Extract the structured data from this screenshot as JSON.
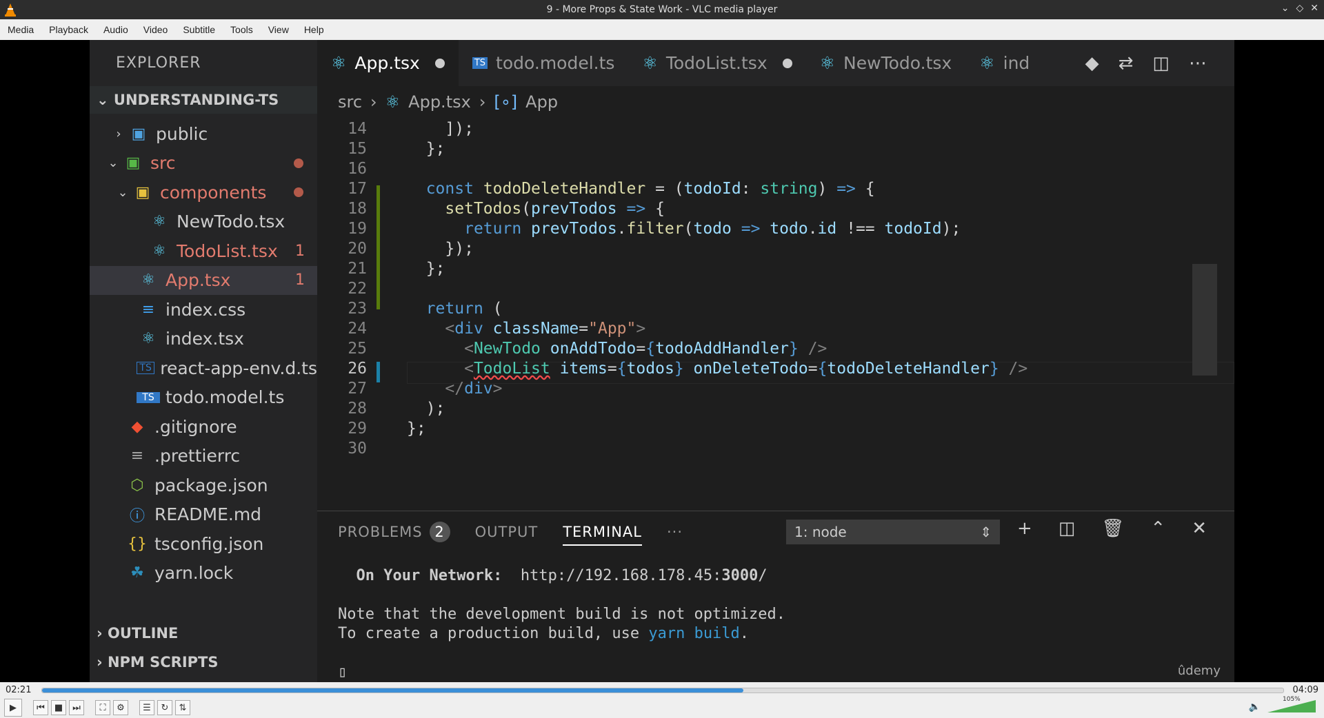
{
  "window": {
    "title": "9 - More Props & State Work - VLC media player"
  },
  "menu": [
    "Media",
    "Playback",
    "Audio",
    "Video",
    "Subtitle",
    "Tools",
    "View",
    "Help"
  ],
  "explorer": {
    "title": "EXPLORER",
    "project": "UNDERSTANDING-TS",
    "items": [
      {
        "label": "public",
        "kind": "folder"
      },
      {
        "label": "src",
        "kind": "folder-open"
      },
      {
        "label": "components",
        "kind": "folder-open"
      },
      {
        "label": "NewTodo.tsx",
        "kind": "react"
      },
      {
        "label": "TodoList.tsx",
        "kind": "react",
        "badge": "1"
      },
      {
        "label": "App.tsx",
        "kind": "react",
        "badge": "1"
      },
      {
        "label": "index.css",
        "kind": "css"
      },
      {
        "label": "index.tsx",
        "kind": "react"
      },
      {
        "label": "react-app-env.d.ts",
        "kind": "ts"
      },
      {
        "label": "todo.model.ts",
        "kind": "ts"
      },
      {
        "label": ".gitignore",
        "kind": "git"
      },
      {
        "label": ".prettierrc",
        "kind": "config"
      },
      {
        "label": "package.json",
        "kind": "json"
      },
      {
        "label": "README.md",
        "kind": "info"
      },
      {
        "label": "tsconfig.json",
        "kind": "json"
      },
      {
        "label": "yarn.lock",
        "kind": "yarn"
      }
    ],
    "sections": [
      "OUTLINE",
      "NPM SCRIPTS"
    ]
  },
  "tabs": [
    "App.tsx",
    "todo.model.ts",
    "TodoList.tsx",
    "NewTodo.tsx",
    "ind"
  ],
  "breadcrumb": [
    "src",
    "App.tsx",
    "App"
  ],
  "code": {
    "line_numbers": [
      "14",
      "15",
      "16",
      "17",
      "18",
      "19",
      "20",
      "21",
      "22",
      "23",
      "24",
      "25",
      "26",
      "27",
      "28",
      "29",
      "30"
    ]
  },
  "panel": {
    "tabs": [
      "PROBLEMS",
      "OUTPUT",
      "TERMINAL",
      "···"
    ],
    "problems_count": "2",
    "terminal_select": "1: node",
    "terminal_lines": {
      "network_label": "On Your Network:",
      "network_url": "http://192.168.178.45:",
      "network_port": "3000",
      "network_tail": "/",
      "note1": "Note that the development build is not optimized.",
      "note2a": "To create a production build, use ",
      "note2b": "yarn build",
      "note2c": "."
    },
    "watermark": "ûdemy"
  },
  "player": {
    "elapsed": "02:21",
    "total": "04:09",
    "progress": 0.565,
    "volume": "105%"
  },
  "colors": {
    "accent": "#3b8fd8",
    "vscode_bg": "#1e1e1e"
  }
}
